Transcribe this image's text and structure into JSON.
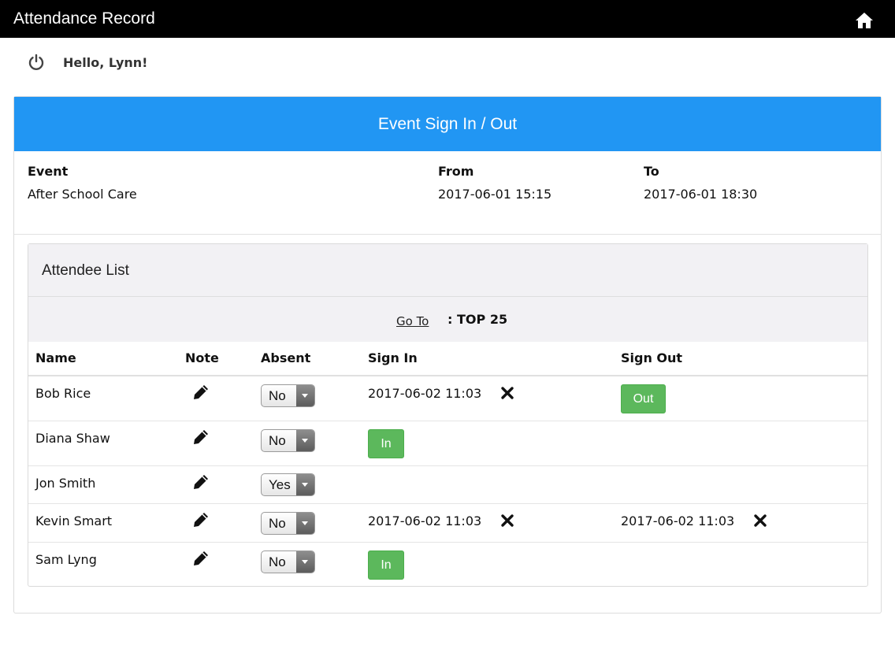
{
  "app": {
    "title": "Attendance Record"
  },
  "user": {
    "greeting": "Hello, Lynn!"
  },
  "panel": {
    "title": "Event Sign In / Out"
  },
  "event": {
    "labels": {
      "event": "Event",
      "from": "From",
      "to": "To"
    },
    "name": "After School Care",
    "from": "2017-06-01 15:15",
    "to": "2017-06-01 18:30"
  },
  "attendees": {
    "title": "Attendee List",
    "goto_label": "Go To",
    "goto_separator": ":",
    "goto_value": "TOP 25",
    "columns": {
      "name": "Name",
      "note": "Note",
      "absent": "Absent",
      "sign_in": "Sign In",
      "sign_out": "Sign Out"
    },
    "in_label": "In",
    "out_label": "Out",
    "rows": [
      {
        "name": "Bob Rice",
        "absent": "No",
        "sign_in": "2017-06-02 11:03",
        "sign_out": ""
      },
      {
        "name": "Diana Shaw",
        "absent": "No",
        "sign_in": "",
        "sign_out": ""
      },
      {
        "name": "Jon Smith",
        "absent": "Yes",
        "sign_in": "",
        "sign_out": ""
      },
      {
        "name": "Kevin Smart",
        "absent": "No",
        "sign_in": "2017-06-02 11:03",
        "sign_out": "2017-06-02 11:03"
      },
      {
        "name": "Sam Lyng",
        "absent": "No",
        "sign_in": "",
        "sign_out": ""
      }
    ]
  },
  "icons": {
    "home": "home-icon",
    "power": "power-icon",
    "note": "pencil-icon",
    "remove": "close-icon"
  },
  "colors": {
    "topbar": "#000000",
    "panel_header": "#2196F3",
    "list_header_bg": "#F2F1F4",
    "button_green": "#5CB85C"
  }
}
